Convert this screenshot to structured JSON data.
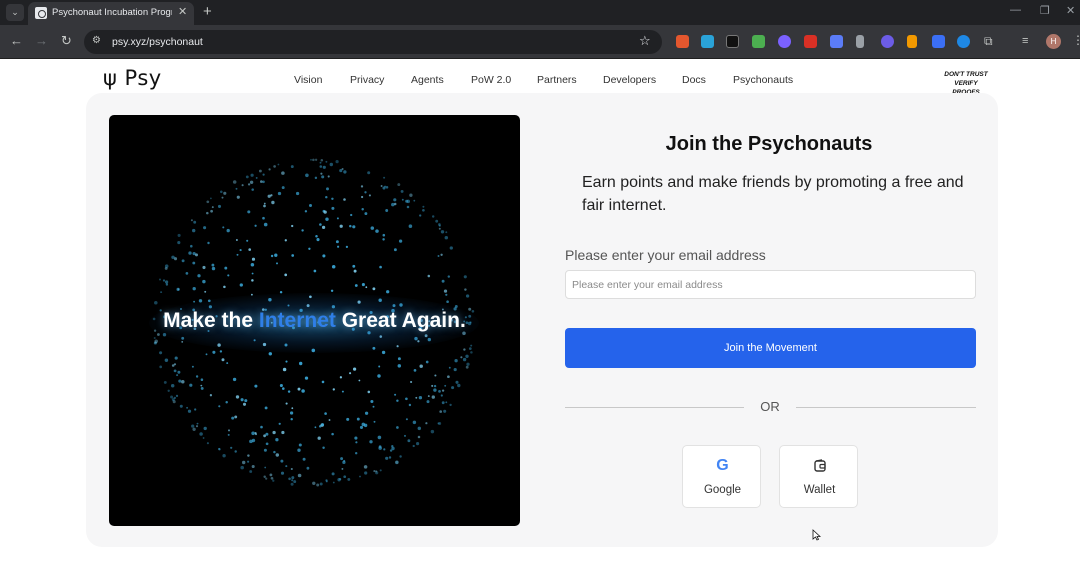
{
  "browser": {
    "tab_title": "Psychonaut Incubation Program",
    "tab_close": "✕",
    "new_tab": "+",
    "url": "psy.xyz/psychonaut",
    "profile_initial": "H",
    "icons": [
      "menu-icon",
      "favicon",
      "back-icon",
      "forward-icon",
      "reload-icon",
      "tune-icon",
      "star-icon",
      "extensions-icon",
      "kebab-icon"
    ]
  },
  "site": {
    "logo": "ψ Psy",
    "nav": [
      "Vision",
      "Privacy",
      "Agents",
      "PoW 2.0",
      "Partners",
      "Developers",
      "Docs",
      "Psychonauts"
    ],
    "tagline_line1": "DON'T TRUST",
    "tagline_line2": "VERIFY PROOFS"
  },
  "hero": {
    "text_before": "Make the ",
    "text_highlight": "Internet",
    "text_after": " Great Again."
  },
  "form": {
    "title": "Join the Psychonauts",
    "subtitle": "Earn points and make friends by promoting a free and fair internet.",
    "email_label": "Please enter your email address",
    "email_placeholder": "Please enter your email address",
    "email_value": "",
    "join_button": "Join the Movement",
    "or_text": "OR",
    "google_label": "Google",
    "wallet_label": "Wallet"
  },
  "colors": {
    "accent": "#2563eb",
    "hero_highlight": "#2f7fe8",
    "hero_bg": "#000000",
    "card_bg": "#f6f6f7"
  }
}
